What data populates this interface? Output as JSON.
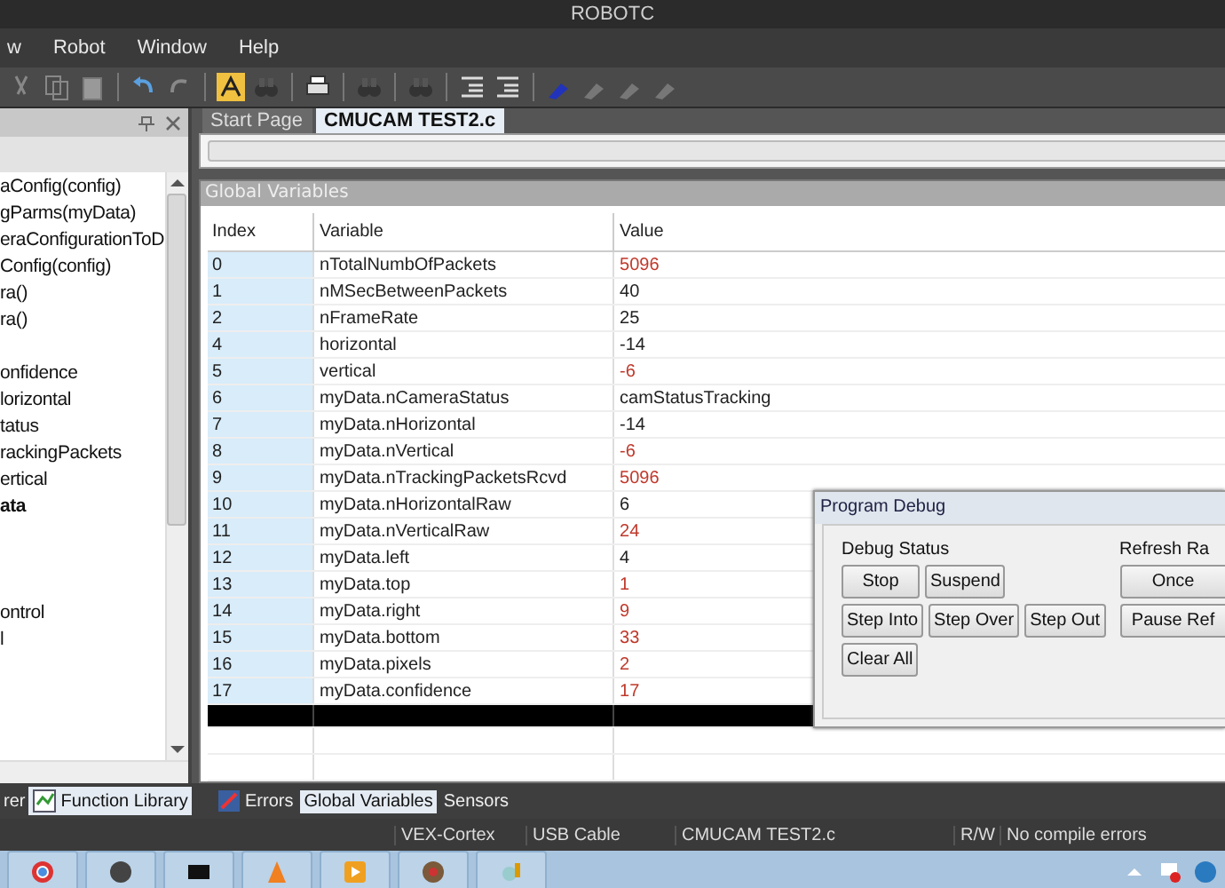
{
  "window": {
    "title": "ROBOTC"
  },
  "menu": [
    "w",
    "Robot",
    "Window",
    "Help"
  ],
  "left_panel": {
    "items": [
      {
        "kind": "entry",
        "label": "aConfig(config)",
        "bold": false
      },
      {
        "kind": "entry",
        "label": "gParms(myData)",
        "bold": false
      },
      {
        "kind": "entry",
        "label": "eraConfigurationToD",
        "bold": false
      },
      {
        "kind": "entry",
        "label": "Config(config)",
        "bold": false
      },
      {
        "kind": "entry",
        "label": "ra()",
        "bold": false
      },
      {
        "kind": "entry",
        "label": "ra()",
        "bold": false
      },
      {
        "kind": "blank"
      },
      {
        "kind": "entry",
        "label": "onfidence",
        "bold": false
      },
      {
        "kind": "entry",
        "label": "lorizontal",
        "bold": false
      },
      {
        "kind": "entry",
        "label": "tatus",
        "bold": false
      },
      {
        "kind": "entry",
        "label": "rackingPackets",
        "bold": false
      },
      {
        "kind": "entry",
        "label": "ertical",
        "bold": false
      },
      {
        "kind": "entry",
        "label": "ata",
        "bold": true
      },
      {
        "kind": "blank"
      },
      {
        "kind": "blank"
      },
      {
        "kind": "blank"
      },
      {
        "kind": "entry",
        "label": "ontrol",
        "bold": false
      },
      {
        "kind": "entry",
        "label": "l",
        "bold": false
      }
    ]
  },
  "editor_tabs": [
    {
      "label": "Start Page",
      "selected": false
    },
    {
      "label": "CMUCAM TEST2.c",
      "selected": true
    }
  ],
  "global_variables": {
    "title": "Global Variables",
    "columns": [
      "Index",
      "Variable",
      "Value"
    ],
    "rows": [
      {
        "index": "0",
        "variable": "nTotalNumbOfPackets",
        "value": "5096",
        "changed": true
      },
      {
        "index": "1",
        "variable": "nMSecBetweenPackets",
        "value": "40",
        "changed": false
      },
      {
        "index": "2",
        "variable": "nFrameRate",
        "value": "25",
        "changed": false
      },
      {
        "index": "4",
        "variable": "horizontal",
        "value": "-14",
        "changed": false
      },
      {
        "index": "5",
        "variable": "vertical",
        "value": "-6",
        "changed": true
      },
      {
        "index": "6",
        "variable": "myData.nCameraStatus",
        "value": "camStatusTracking",
        "changed": false
      },
      {
        "index": "7",
        "variable": "myData.nHorizontal",
        "value": "-14",
        "changed": false
      },
      {
        "index": "8",
        "variable": "myData.nVertical",
        "value": "-6",
        "changed": true
      },
      {
        "index": "9",
        "variable": "myData.nTrackingPacketsRcvd",
        "value": "5096",
        "changed": true
      },
      {
        "index": "10",
        "variable": "myData.nHorizontalRaw",
        "value": "6",
        "changed": false
      },
      {
        "index": "11",
        "variable": "myData.nVerticalRaw",
        "value": "24",
        "changed": true
      },
      {
        "index": "12",
        "variable": "myData.left",
        "value": "4",
        "changed": false
      },
      {
        "index": "13",
        "variable": "myData.top",
        "value": "1",
        "changed": true
      },
      {
        "index": "14",
        "variable": "myData.right",
        "value": "9",
        "changed": true
      },
      {
        "index": "15",
        "variable": "myData.bottom",
        "value": "33",
        "changed": true
      },
      {
        "index": "16",
        "variable": "myData.pixels",
        "value": "2",
        "changed": true
      },
      {
        "index": "17",
        "variable": "myData.confidence",
        "value": "17",
        "changed": true
      }
    ]
  },
  "program_debug": {
    "title": "Program Debug",
    "debug_status": {
      "label": "Debug Status",
      "buttons": [
        "Stop",
        "Suspend",
        "Step Into",
        "Step Over",
        "Step Out",
        "Clear All"
      ]
    },
    "refresh_rate": {
      "label": "Refresh Ra",
      "buttons": [
        "Once",
        "Pause Ref"
      ]
    }
  },
  "left_tabs": [
    {
      "label": "rer",
      "selected": false
    },
    {
      "label": "Function Library",
      "selected": true
    }
  ],
  "bottom_tabs": [
    {
      "label": "Errors",
      "selected": false
    },
    {
      "label": "Global Variables",
      "selected": true
    },
    {
      "label": "Sensors",
      "selected": false
    }
  ],
  "status_bar": [
    "VEX-Cortex",
    "USB Cable",
    "CMUCAM TEST2.c",
    "R/W",
    "No compile errors"
  ]
}
